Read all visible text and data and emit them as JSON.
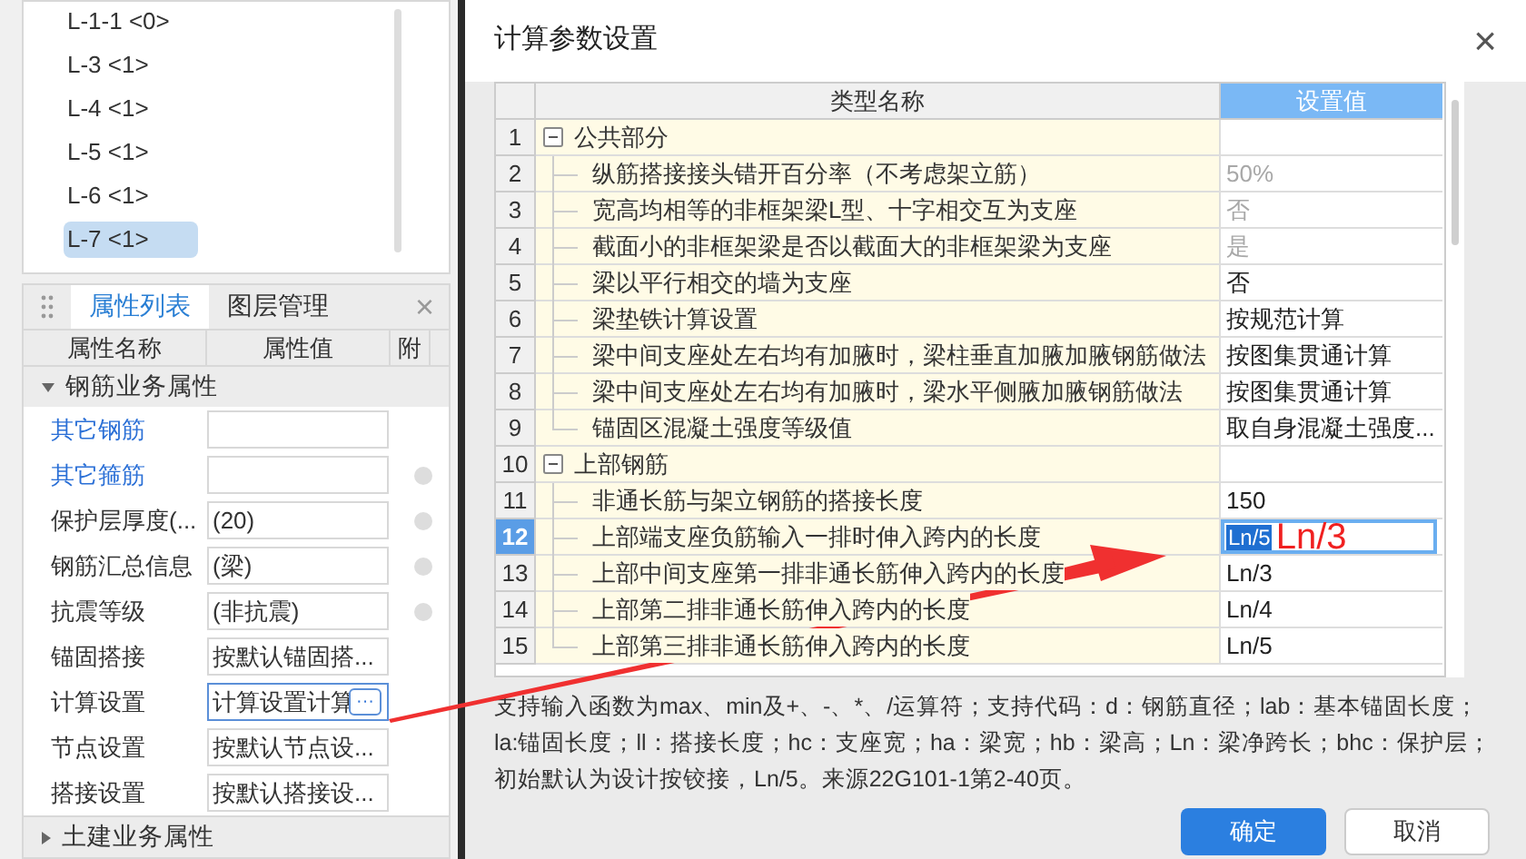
{
  "tree": {
    "items": [
      {
        "label": "L-1-1 <0>",
        "selected": false
      },
      {
        "label": "L-3 <1>",
        "selected": false
      },
      {
        "label": "L-4 <1>",
        "selected": false
      },
      {
        "label": "L-5 <1>",
        "selected": false
      },
      {
        "label": "L-6 <1>",
        "selected": false
      },
      {
        "label": "L-7 <1>",
        "selected": true
      }
    ]
  },
  "properties_panel": {
    "tabs": [
      {
        "label": "属性列表",
        "selected": true
      },
      {
        "label": "图层管理",
        "selected": false
      }
    ],
    "close": "×",
    "columns": [
      "属性名称",
      "属性值",
      "附"
    ],
    "groups": [
      {
        "label": "钢筋业务属性",
        "expanded": true,
        "rows": [
          {
            "name": "其它钢筋",
            "linked": true,
            "attach_box": false,
            "selected": false
          },
          {
            "name": "其它箍筋",
            "linked": true,
            "attach_box": true,
            "selected": false
          },
          {
            "name": "保护层厚度(...",
            "value": "(20)",
            "linked": false,
            "attach_box": true,
            "selected": false
          },
          {
            "name": "钢筋汇总信息",
            "value": "(梁)",
            "linked": false,
            "attach_box": true,
            "selected": false
          },
          {
            "name": "抗震等级",
            "value": "(非抗震)",
            "linked": false,
            "attach_box": true,
            "selected": false
          },
          {
            "name": "锚固搭接",
            "value": "按默认锚固搭...",
            "linked": false,
            "attach_box": false,
            "selected": false
          },
          {
            "name": "计算设置",
            "value": "计算设置计算",
            "button": "···",
            "linked": false,
            "attach_box": false,
            "selected": true
          },
          {
            "name": "节点设置",
            "value": "按默认节点设...",
            "linked": false,
            "attach_box": false,
            "selected": false
          },
          {
            "name": "搭接设置",
            "value": "按默认搭接设...",
            "linked": false,
            "attach_box": false,
            "selected": false
          }
        ]
      },
      {
        "label": "土建业务属性",
        "expanded": false
      }
    ]
  },
  "dialog": {
    "title": "计算参数设置",
    "close": "×",
    "table": {
      "columns": [
        "类型名称",
        "设置值"
      ],
      "rows": [
        {
          "no": "1",
          "kind": "group",
          "expanded": true,
          "name": "公共部分",
          "selected": false
        },
        {
          "no": "2",
          "kind": "item",
          "name": "纵筋搭接接头错开百分率（不考虑架立筋）",
          "value": "50%",
          "disabled": true,
          "selected": false
        },
        {
          "no": "3",
          "kind": "item",
          "name": "宽高均相等的非框架梁L型、十字相交互为支座",
          "value": "否",
          "disabled": true,
          "selected": false
        },
        {
          "no": "4",
          "kind": "item",
          "name": "截面小的非框架梁是否以截面大的非框架梁为支座",
          "value": "是",
          "disabled": true,
          "selected": false
        },
        {
          "no": "5",
          "kind": "item",
          "name": "梁以平行相交的墙为支座",
          "value": "否",
          "disabled": false,
          "selected": false
        },
        {
          "no": "6",
          "kind": "item",
          "name": "梁垫铁计算设置",
          "value": "按规范计算",
          "disabled": false,
          "selected": false
        },
        {
          "no": "7",
          "kind": "item",
          "name": "梁中间支座处左右均有加腋时，梁柱垂直加腋加腋钢筋做法",
          "value": "按图集贯通计算",
          "disabled": false,
          "selected": false
        },
        {
          "no": "8",
          "kind": "item",
          "name": "梁中间支座处左右均有加腋时，梁水平侧腋加腋钢筋做法",
          "value": "按图集贯通计算",
          "disabled": false,
          "selected": false
        },
        {
          "no": "9",
          "kind": "item",
          "name": "锚固区混凝土强度等级值",
          "value": "取自身混凝土强度...",
          "disabled": false,
          "selected": false
        },
        {
          "no": "10",
          "kind": "group",
          "expanded": true,
          "name": "上部钢筋",
          "selected": false
        },
        {
          "no": "11",
          "kind": "item",
          "name": "非通长筋与架立钢筋的搭接长度",
          "value": "150",
          "disabled": false,
          "selected": false
        },
        {
          "no": "12",
          "kind": "item",
          "name": "上部端支座负筋输入一排时伸入跨内的长度",
          "value": "Ln/5",
          "disabled": false,
          "selected": true
        },
        {
          "no": "13",
          "kind": "item",
          "name": "上部中间支座第一排非通长筋伸入跨内的长度",
          "value": "Ln/3",
          "disabled": false,
          "selected": false
        },
        {
          "no": "14",
          "kind": "item",
          "name": "上部第二排非通长筋伸入跨内的长度",
          "value": "Ln/4",
          "disabled": false,
          "selected": false
        },
        {
          "no": "15",
          "kind": "item",
          "name": "上部第三排非通长筋伸入跨内的长度",
          "value": "Ln/5",
          "disabled": false,
          "selected": false
        }
      ]
    },
    "note": "支持输入函数为max、min及+、-、*、/运算符；支持代码：d：钢筋直径；lab：基本锚固长度；la:锚固长度；ll：搭接长度；hc：支座宽；ha：梁宽；hb：梁高；Ln：梁净跨长；bhc：保护层；初始默认为设计按铰接，Ln/5。来源22G101-1第2-40页。",
    "buttons": [
      {
        "label": "确定",
        "kind": "primary"
      },
      {
        "label": "取消",
        "kind": "secondary"
      }
    ]
  },
  "annotation": {
    "text": "Ln/3"
  }
}
